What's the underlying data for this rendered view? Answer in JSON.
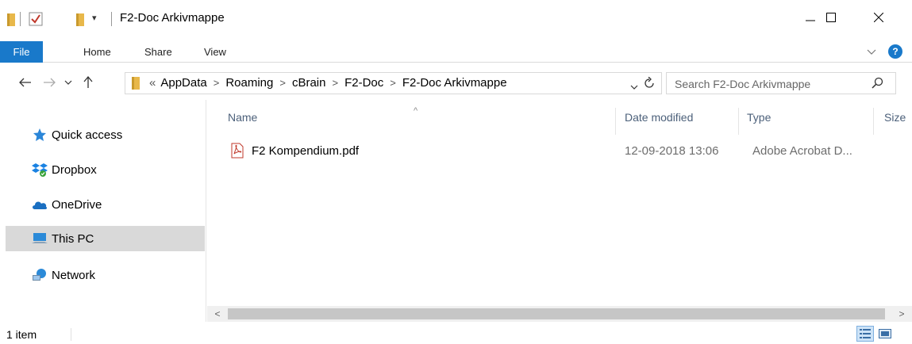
{
  "window": {
    "title": "F2-Doc Arkivmappe",
    "minimize_glyph": "—",
    "maximize_glyph": "☐",
    "close_glyph": "✕"
  },
  "ribbon": {
    "tabs": [
      "File",
      "Home",
      "Share",
      "View"
    ],
    "help_glyph": "?",
    "expand_glyph": "⌄"
  },
  "address": {
    "path_overflow": "«",
    "crumbs": [
      "AppData",
      "Roaming",
      "cBrain",
      "F2-Doc",
      "F2-Doc Arkivmappe"
    ],
    "search_placeholder": "Search F2-Doc Arkivmappe"
  },
  "sidebar": {
    "items": [
      {
        "label": "Quick access",
        "icon": "star-icon"
      },
      {
        "label": "Dropbox",
        "icon": "dropbox-icon"
      },
      {
        "label": "OneDrive",
        "icon": "onedrive-icon"
      },
      {
        "label": "This PC",
        "icon": "computer-icon",
        "selected": true
      },
      {
        "label": "Network",
        "icon": "network-icon"
      }
    ]
  },
  "filelist": {
    "columns": [
      "Name",
      "Date modified",
      "Type",
      "Size"
    ],
    "files": [
      {
        "name": "F2 Kompendium.pdf",
        "date_modified": "12-09-2018 13:06",
        "type": "Adobe Acrobat D...",
        "icon": "pdf-icon"
      }
    ]
  },
  "status": {
    "item_count": "1 item"
  },
  "colors": {
    "accent": "#1979ca",
    "selected_bg": "#d9d9d9",
    "header_text": "#4c607a"
  }
}
